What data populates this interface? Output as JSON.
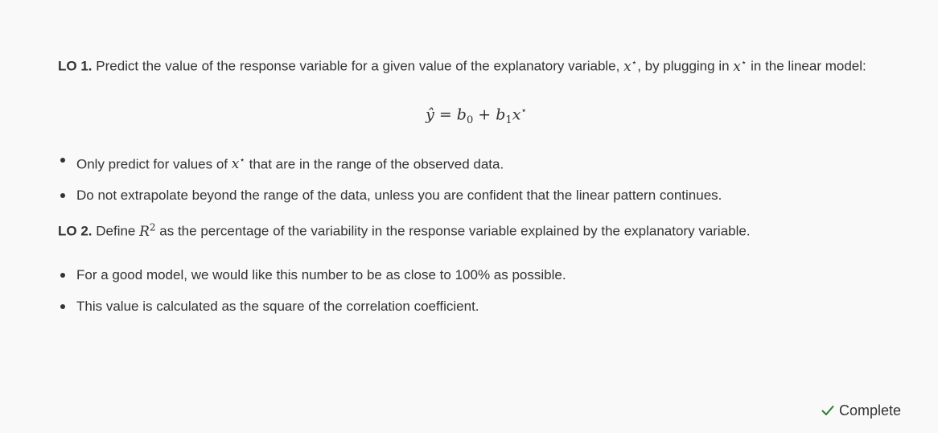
{
  "lo1": {
    "label": "LO 1.",
    "text_before": " Predict the value of the response variable for a given value of the explanatory variable, ",
    "var_x_star": "x*",
    "text_middle": ", by plugging in ",
    "text_after": " in the linear model:"
  },
  "equation": {
    "lhs": "ŷ",
    "equals": " = ",
    "b0": "b",
    "b0_sub": "0",
    "plus": " + ",
    "b1": "b",
    "b1_sub": "1",
    "x": "x",
    "star": "*"
  },
  "bullets1": [
    {
      "before": "Only predict for values of ",
      "var": "x*",
      "after": " that are in the range of the observed data."
    },
    {
      "text": "Do not extrapolate beyond the range of the data, unless you are confident that the linear pattern continues."
    }
  ],
  "lo2": {
    "label": "LO 2.",
    "text_before": " Define ",
    "r": "R",
    "r_sup": "2",
    "text_after": " as the percentage of the variability in the response variable explained by the explanatory variable."
  },
  "bullets2": [
    {
      "text": "For a good model, we would like this number to be as close to 100% as possible."
    },
    {
      "text": "This value is calculated as the square of the correlation coefficient."
    }
  ],
  "status": {
    "label": "Complete",
    "icon": "check-icon",
    "color": "#2e7d32"
  }
}
